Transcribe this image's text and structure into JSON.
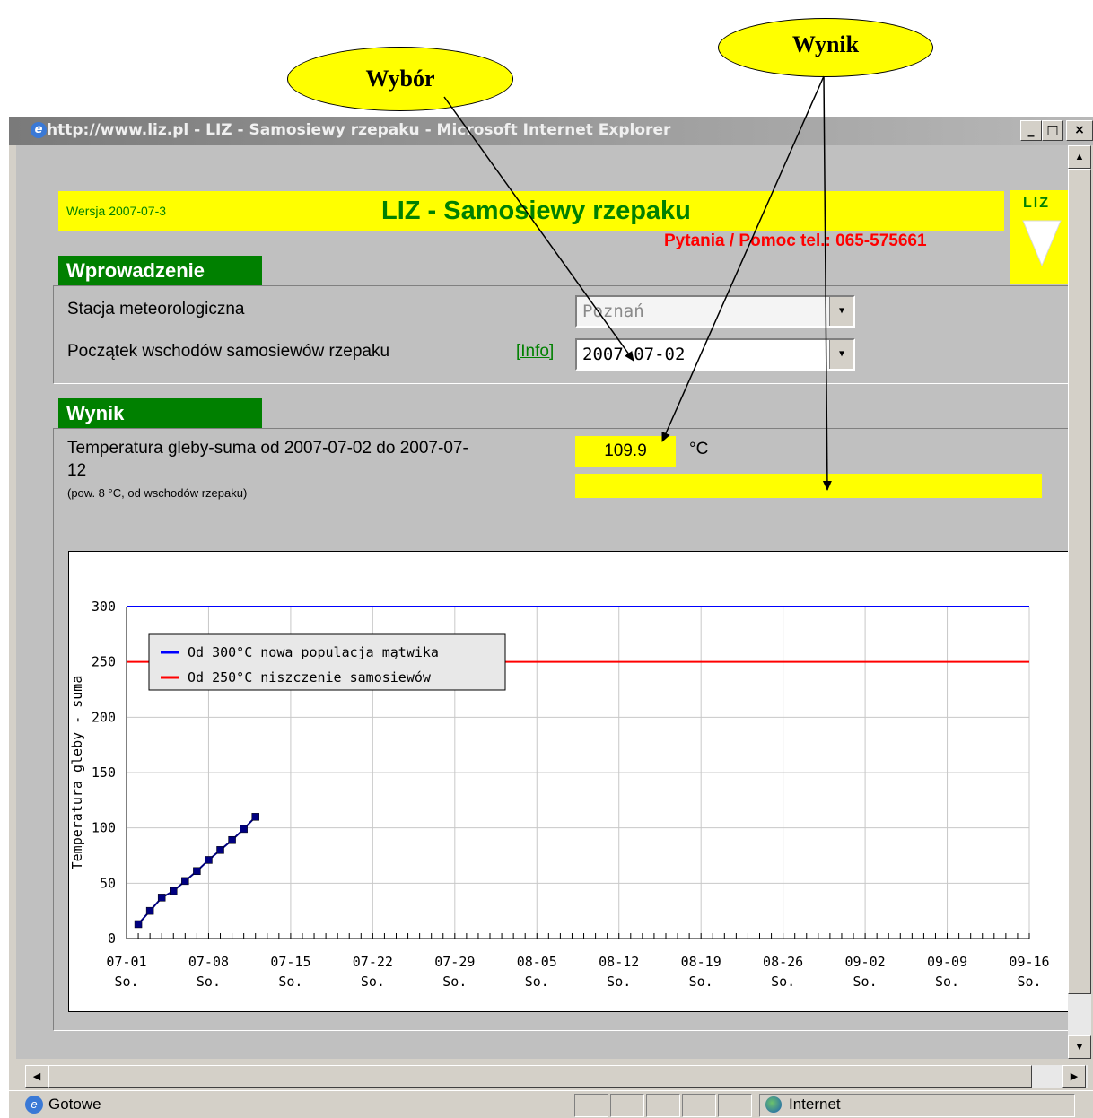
{
  "callouts": {
    "wybor": "Wybór",
    "wynik": "Wynik"
  },
  "window": {
    "title": "http://www.liz.pl - LIZ - Samosiewy rzepaku - Microsoft Internet Explorer",
    "buttons": {
      "minimize": "_",
      "maximize": "□",
      "close": "×"
    }
  },
  "header": {
    "version": "Wersja 2007-07-3",
    "title": "LIZ - Samosiewy rzepaku",
    "help": "Pytania / Pomoc tel.: 065-575661",
    "logo_text": "LIZ"
  },
  "input_section": {
    "tab": "Wprowadzenie",
    "station_label": "Stacja meteorologiczna",
    "station_value": "Poznań",
    "start_label": "Początek wschodów samosiewów rzepaku",
    "info_link": "[Info]",
    "start_value": "2007-07-02"
  },
  "result_section": {
    "tab": "Wynik",
    "result_label_line1": "Temperatura gleby-suma od 2007-07-02 do 2007-07-",
    "result_label_line2": "12",
    "result_note": "(pow. 8 °C, od wschodów rzepaku)",
    "result_value": "109.9",
    "result_unit": "°C"
  },
  "statusbar": {
    "status": "Gotowe",
    "zone": "Internet"
  },
  "chart_data": {
    "type": "line",
    "ylabel": "Temperatura gleby - suma",
    "ylim": [
      0,
      300
    ],
    "y_ticks": [
      0,
      50,
      100,
      150,
      200,
      250,
      300
    ],
    "x_tick_labels": [
      "07-01",
      "07-08",
      "07-15",
      "07-22",
      "07-29",
      "08-05",
      "08-12",
      "08-19",
      "08-26",
      "09-02",
      "09-09",
      "09-16"
    ],
    "x_tick_sub": "So.",
    "x_range_days": [
      0,
      77
    ],
    "legend": [
      "Od 300°C nowa populacja mątwika",
      "Od 250°C niszczenie samosiewów"
    ],
    "series": [
      {
        "name": "Od 300°C nowa populacja mątwika",
        "color": "#0000ff",
        "x_days": [
          0,
          77
        ],
        "values": [
          300,
          300
        ]
      },
      {
        "name": "Od 250°C niszczenie samosiewów",
        "color": "#ff0000",
        "x_days": [
          0,
          77
        ],
        "values": [
          250,
          250
        ]
      },
      {
        "color": "#000080",
        "x_days": [
          1,
          2,
          3,
          4,
          5,
          6,
          7,
          8,
          9,
          10,
          11
        ],
        "values": [
          13,
          25,
          37,
          43,
          52,
          61,
          71,
          80,
          89,
          99,
          110
        ]
      }
    ]
  }
}
